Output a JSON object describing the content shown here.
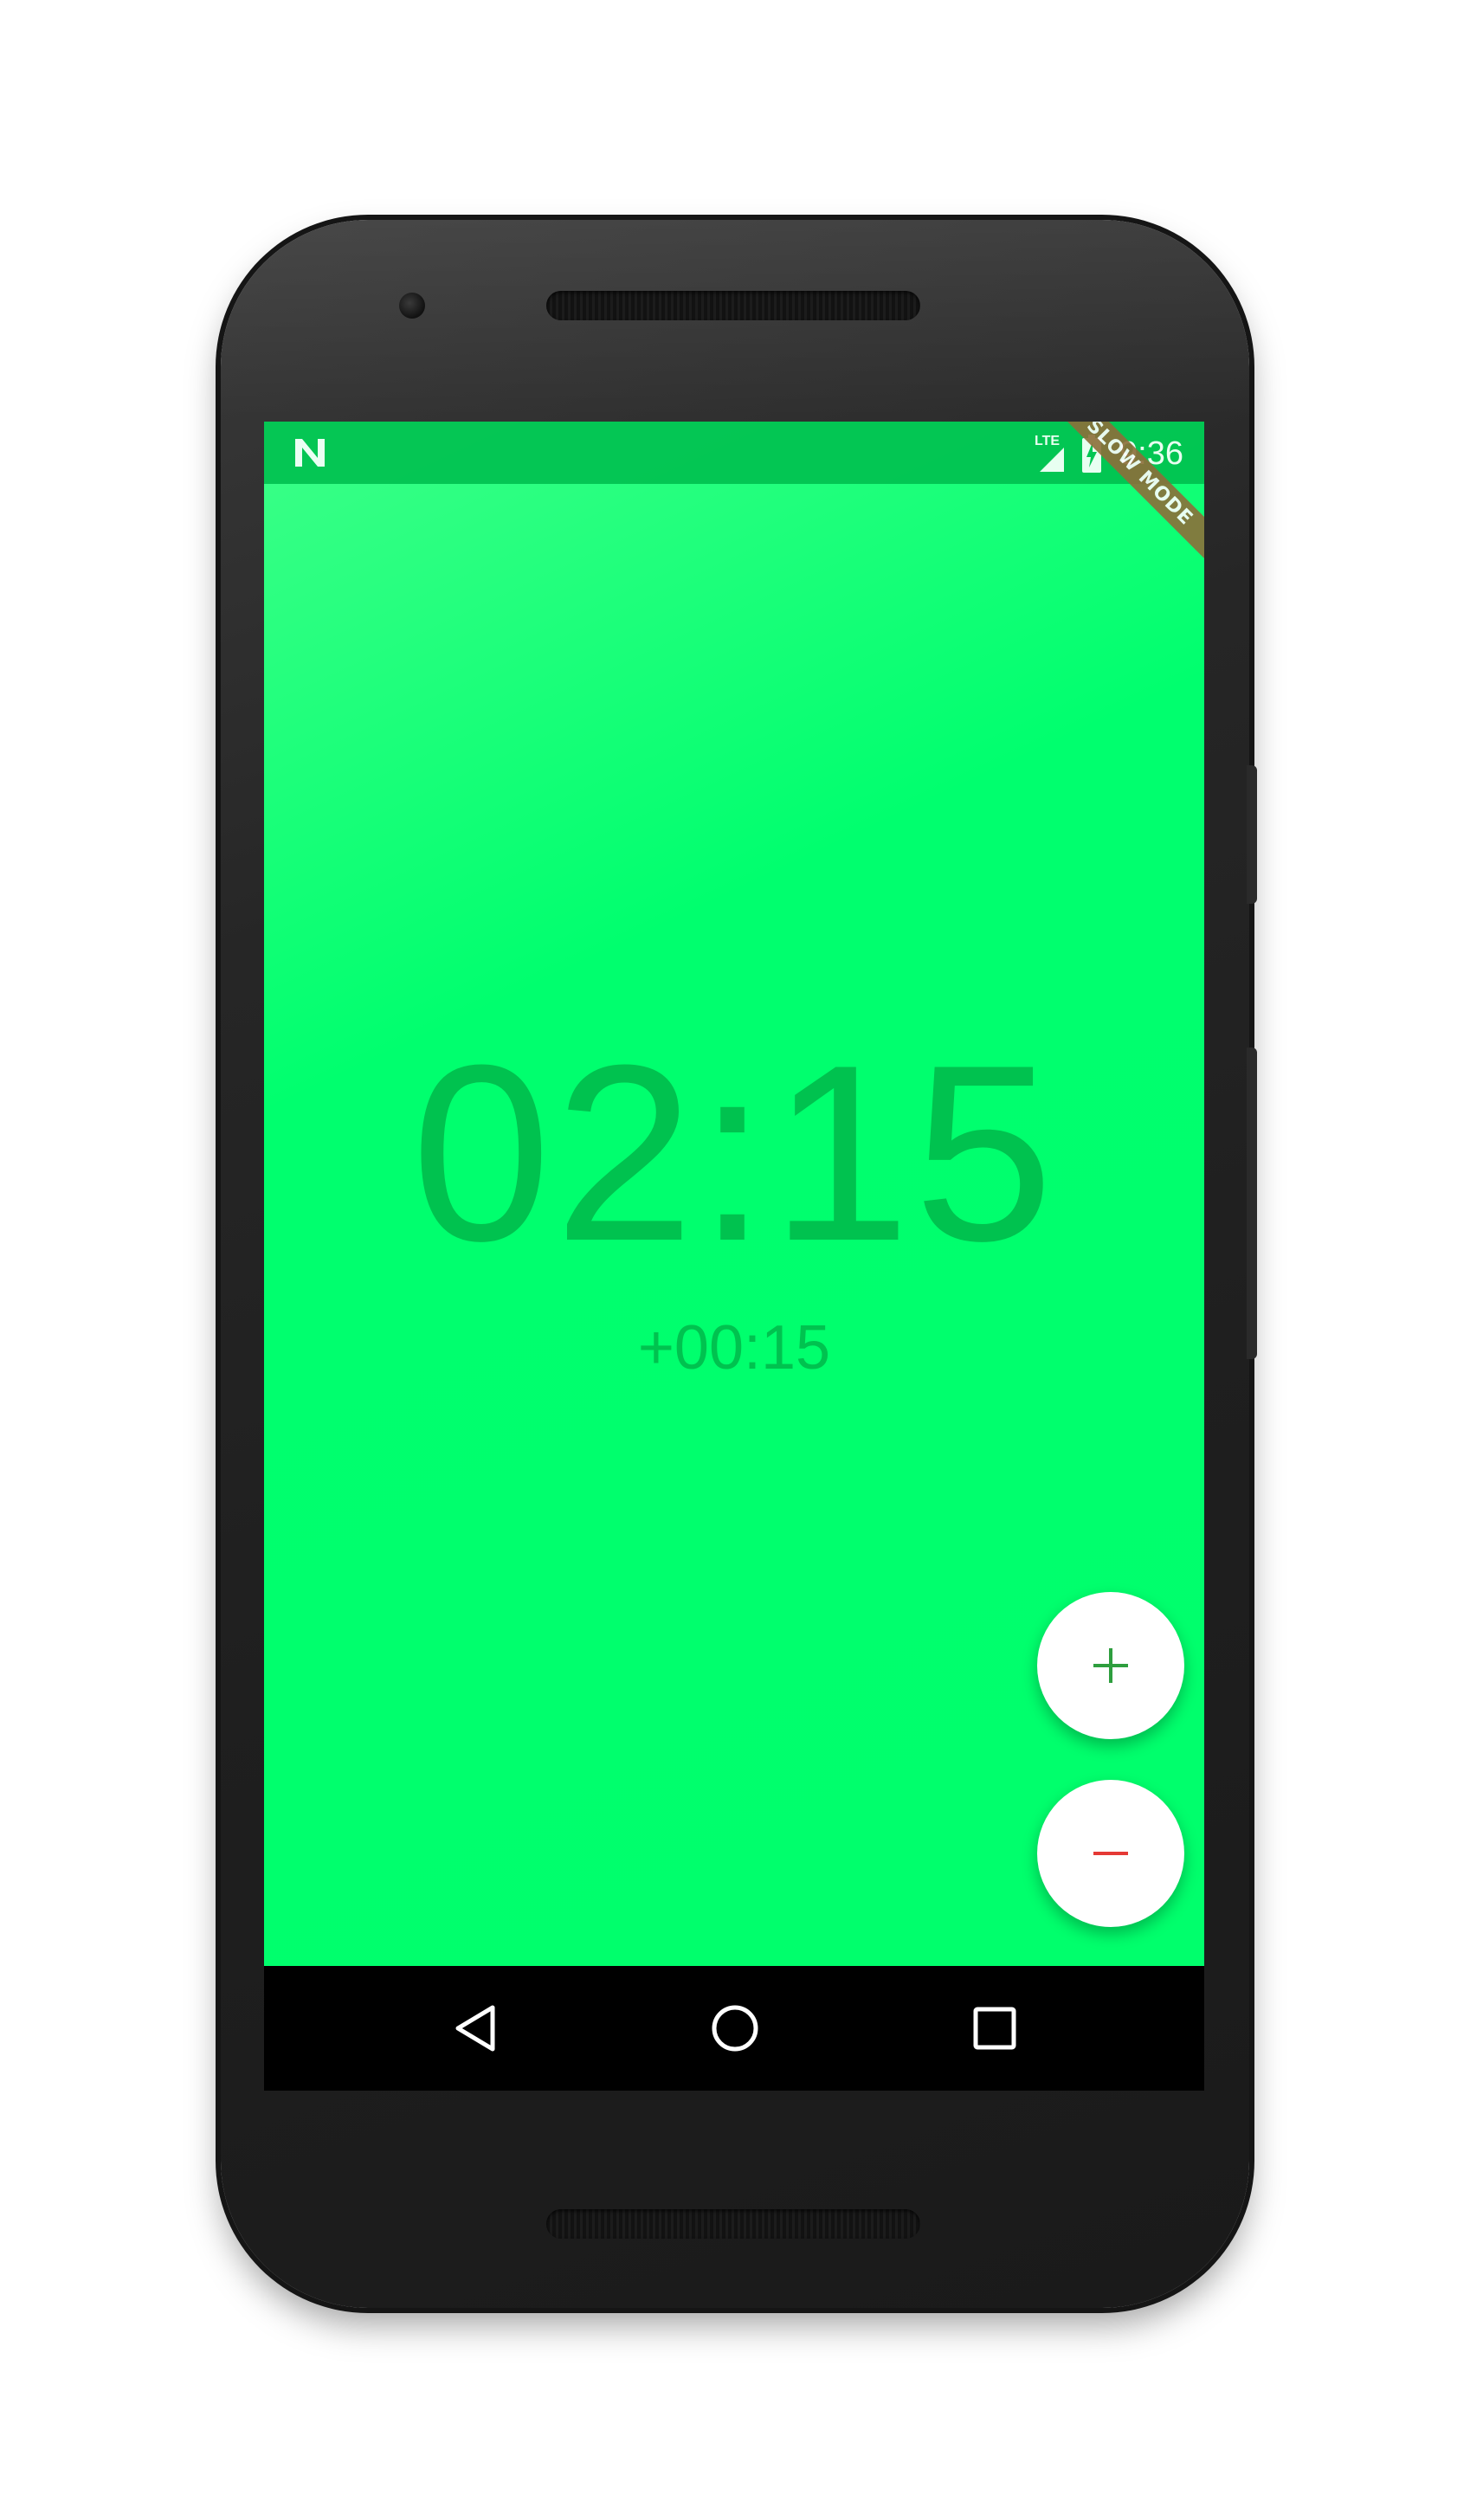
{
  "status_bar": {
    "network_label": "LTE",
    "time": "9:36",
    "notification_icon": "n-letter-icon"
  },
  "debug_banner": {
    "label": "SLOW MODE",
    "color": "#8d6e3a"
  },
  "timer": {
    "display": "02:15",
    "increment": "+00:15"
  },
  "fab_buttons": {
    "plus_symbol": "+",
    "minus_symbol": "−",
    "plus_color": "#2e9e3e",
    "minus_color": "#e53935"
  },
  "navigation": {
    "back_icon": "back-triangle-icon",
    "home_icon": "home-circle-icon",
    "recents_icon": "recents-square-icon"
  },
  "colors": {
    "screen_background": "#00ff6c",
    "status_bar": "#00c04f",
    "timer_text": "#00c24f",
    "nav_bar": "#000000"
  }
}
